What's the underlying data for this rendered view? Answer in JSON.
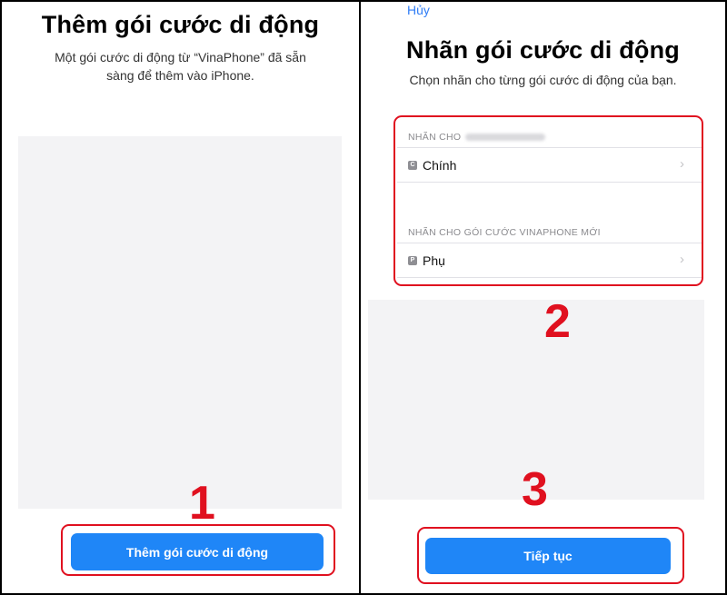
{
  "left_panel": {
    "title": "Thêm gói cước di động",
    "subtitle_line1": "Một gói cước di động từ “VinaPhone” đã sẵn",
    "subtitle_line2": "sàng để thêm vào iPhone.",
    "button_label": "Thêm gói cước di động",
    "step_number": "1"
  },
  "right_panel": {
    "cancel_label": "Hủy",
    "title": "Nhãn gói cước di động",
    "subtitle": "Chọn nhãn cho từng gói cước di động của bạn.",
    "section1_header": "NHÃN CHO",
    "section1_tag": "C",
    "section1_value": "Chính",
    "section2_header": "NHÃN CHO GÓI CƯỚC VINAPHONE MỚI",
    "section2_tag": "P",
    "section2_value": "Phụ",
    "step_number_2": "2",
    "button_label": "Tiếp tục",
    "step_number_3": "3"
  },
  "colors": {
    "accent_blue": "#1f86f7",
    "link_blue": "#2f7df6",
    "annotation_red": "#e0101f"
  }
}
